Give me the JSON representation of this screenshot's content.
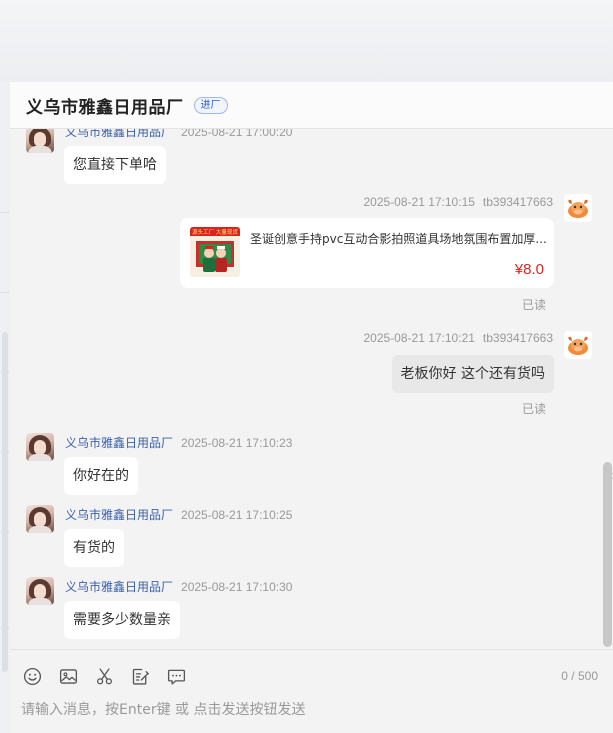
{
  "header": {
    "shop_name": "义乌市雅鑫日用品厂",
    "badge": "进厂"
  },
  "messages": [
    {
      "side": "left",
      "sender": "义乌市雅鑫日用品厂",
      "time": "2025-08-21 17:00:20",
      "text": "您直接下单哈"
    },
    {
      "side": "right",
      "sender": "tb393417663",
      "time": "2025-08-21 17:10:15",
      "type": "product",
      "product": {
        "title": "圣诞创意手持pvc互动合影拍照道具场地氛围布置加厚...",
        "price": "¥8.0",
        "thumb_banner": "源头工厂 大量现货"
      },
      "read": "已读"
    },
    {
      "side": "right",
      "sender": "tb393417663",
      "time": "2025-08-21 17:10:21",
      "text": "老板你好 这个还有货吗",
      "read": "已读"
    },
    {
      "side": "left",
      "sender": "义乌市雅鑫日用品厂",
      "time": "2025-08-21 17:10:23",
      "text": "你好在的"
    },
    {
      "side": "left",
      "sender": "义乌市雅鑫日用品厂",
      "time": "2025-08-21 17:10:25",
      "text": "有货的"
    },
    {
      "side": "left",
      "sender": "义乌市雅鑫日用品厂",
      "time": "2025-08-21 17:10:30",
      "text": "需要多少数量亲"
    }
  ],
  "input": {
    "placeholder": "请输入消息，按Enter键 或 点击发送按钮发送",
    "value": "",
    "counter": "0 / 500"
  },
  "toolbar_icons": [
    "emoji-icon",
    "image-icon",
    "scissors-icon",
    "edit-note-icon",
    "quick-reply-icon"
  ],
  "colors": {
    "accent": "#3c5faa",
    "price": "#e0231a",
    "panel_bg": "#f3f3f3",
    "my_bubble": "#e8e8e8"
  }
}
